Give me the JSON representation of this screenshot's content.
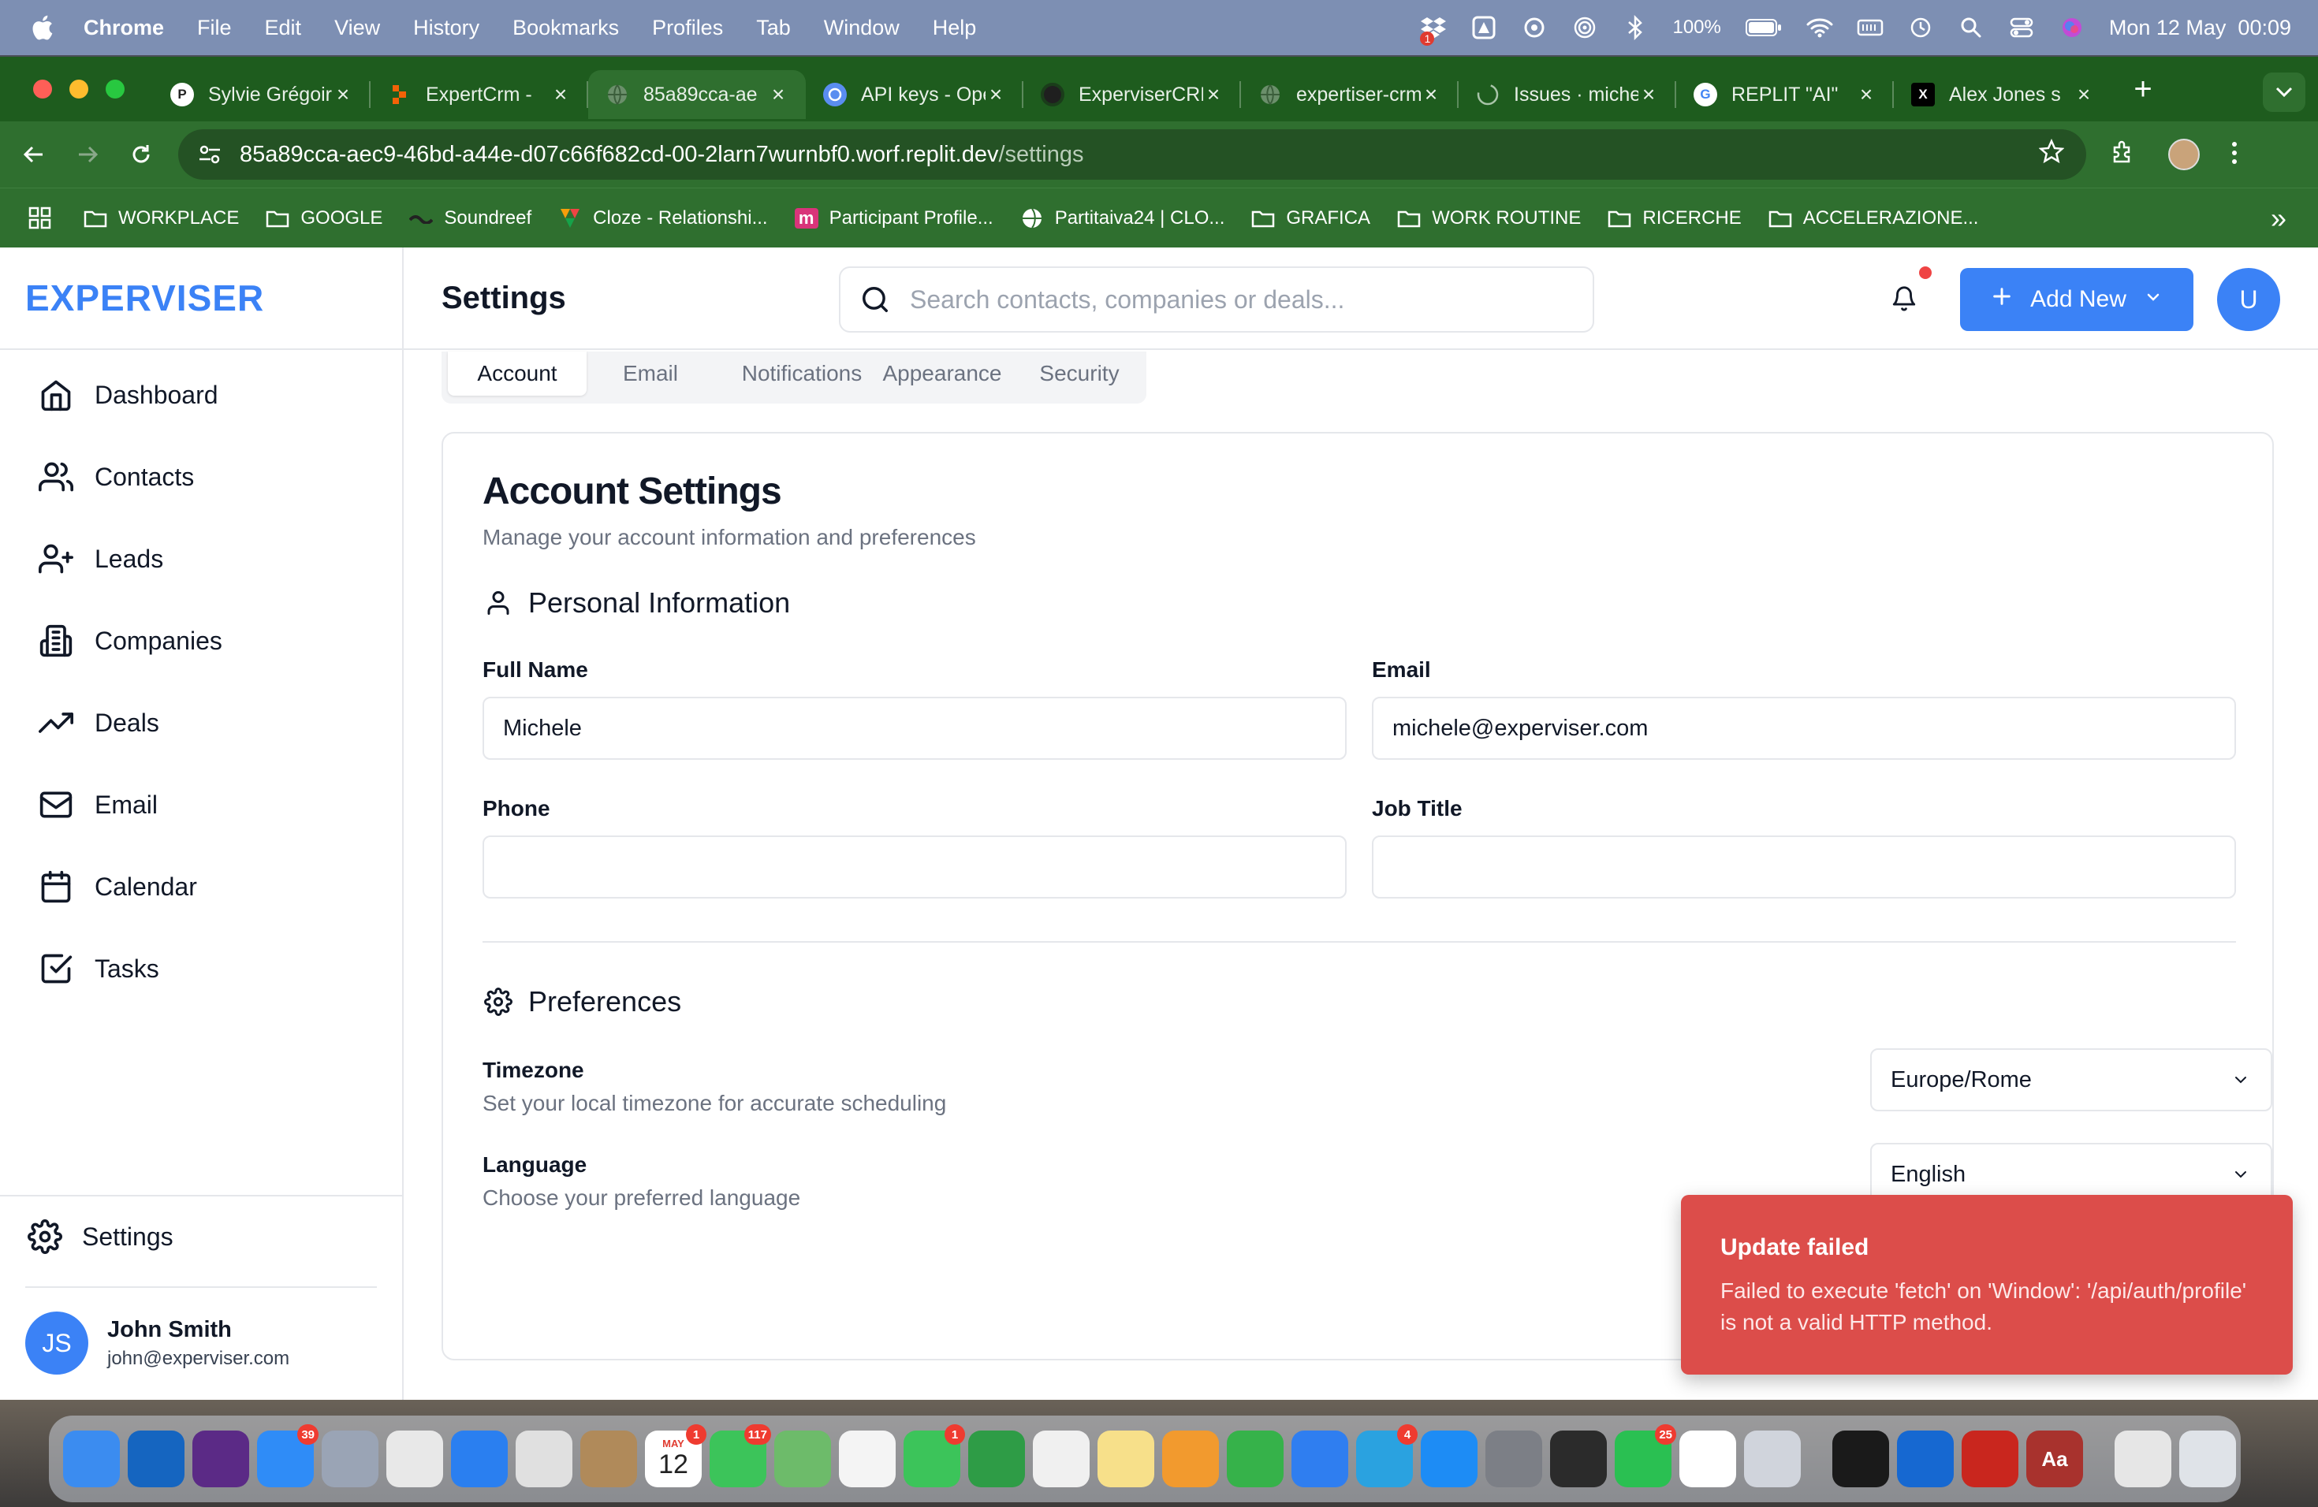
{
  "menubar": {
    "app": "Chrome",
    "items": [
      "File",
      "Edit",
      "View",
      "History",
      "Bookmarks",
      "Profiles",
      "Tab",
      "Window",
      "Help"
    ],
    "battery": "100%",
    "clock": "Mon 12 May  00:09",
    "notification_badge": "1"
  },
  "browser": {
    "tabs": [
      {
        "title": "Sylvie Grégoire",
        "icon": "P"
      },
      {
        "title": "ExpertCrm - ",
        "icon": "replit"
      },
      {
        "title": "85a89cca-ae",
        "icon": "globe",
        "active": true
      },
      {
        "title": "API keys - OpenAI",
        "icon": "openai"
      },
      {
        "title": "ExperviserCRM",
        "icon": "github"
      },
      {
        "title": "expertiser-crm",
        "icon": "globe"
      },
      {
        "title": "Issues · michele",
        "icon": "loading"
      },
      {
        "title": "REPLIT \"AI\"",
        "icon": "G"
      },
      {
        "title": "Alex Jones s",
        "icon": "X"
      }
    ],
    "url_host": "85a89cca-aec9-46bd-a44e-d07c66f682cd-00-2larn7wurnbf0.worf.replit.dev",
    "url_path": "/settings",
    "bookmarks": [
      {
        "label": "WORKPLACE",
        "icon": "folder-icon"
      },
      {
        "label": "GOOGLE",
        "icon": "folder-icon"
      },
      {
        "label": "Soundreef",
        "icon": "soundreef-icon"
      },
      {
        "label": "Cloze - Relationshi...",
        "icon": "cloze-icon"
      },
      {
        "label": "Participant Profile...",
        "icon": "m-icon"
      },
      {
        "label": "Partitaiva24 | CLO...",
        "icon": "globe-icon"
      },
      {
        "label": "GRAFICA",
        "icon": "folder-icon"
      },
      {
        "label": "WORK ROUTINE",
        "icon": "folder-icon"
      },
      {
        "label": "RICERCHE",
        "icon": "folder-icon"
      },
      {
        "label": "ACCELERAZIONE...",
        "icon": "folder-icon"
      }
    ],
    "more": "»"
  },
  "app": {
    "brand": "EXPERVISER",
    "nav": [
      {
        "label": "Dashboard",
        "icon": "home-icon"
      },
      {
        "label": "Contacts",
        "icon": "users-icon"
      },
      {
        "label": "Leads",
        "icon": "user-plus-icon"
      },
      {
        "label": "Companies",
        "icon": "building-icon"
      },
      {
        "label": "Deals",
        "icon": "trending-up-icon"
      },
      {
        "label": "Email",
        "icon": "mail-icon"
      },
      {
        "label": "Calendar",
        "icon": "calendar-icon"
      },
      {
        "label": "Tasks",
        "icon": "check-square-icon"
      }
    ],
    "settings_label": "Settings",
    "user": {
      "initials": "JS",
      "name": "John Smith",
      "email": "john@experviser.com"
    },
    "header": {
      "title": "Settings",
      "search_placeholder": "Search contacts, companies or deals...",
      "add_new": "Add New",
      "avatar_initial": "U"
    },
    "tabs": [
      "Account",
      "Email",
      "Notifications",
      "Appearance",
      "Security"
    ],
    "active_tab": "Account",
    "card": {
      "title": "Account Settings",
      "subtitle": "Manage your account information and preferences",
      "personal_title": "Personal Information",
      "fields": {
        "full_name_label": "Full Name",
        "full_name_value": "Michele",
        "email_label": "Email",
        "email_value": "michele@experviser.com",
        "phone_label": "Phone",
        "phone_value": "",
        "job_title_label": "Job Title",
        "job_title_value": ""
      },
      "preferences_title": "Preferences",
      "timezone_label": "Timezone",
      "timezone_desc": "Set your local timezone for accurate scheduling",
      "timezone_value": "Europe/Rome",
      "language_label": "Language",
      "language_desc": "Choose your preferred language",
      "language_value": "English"
    },
    "toast": {
      "title": "Update failed",
      "message": "Failed to execute 'fetch' on 'Window': '/api/auth/profile' is not a valid HTTP method."
    }
  },
  "dock": {
    "apps": [
      {
        "name": "Finder",
        "color": "#3b8cf0"
      },
      {
        "name": "Outlook",
        "color": "#1565c0"
      },
      {
        "name": "Siri",
        "color": "#5b2a86"
      },
      {
        "name": "Mail",
        "color": "#2f8cf7",
        "badge": "39"
      },
      {
        "name": "Launchpad",
        "color": "#9aa4b5"
      },
      {
        "name": "Chrome",
        "color": "#e8e8e8"
      },
      {
        "name": "Safari",
        "color": "#2a7ff0"
      },
      {
        "name": "Opera",
        "color": "#e0e0e0"
      },
      {
        "name": "Contacts",
        "color": "#b08a5a"
      },
      {
        "name": "Calendar",
        "color": "#ffffff",
        "badge": "1"
      },
      {
        "name": "Messages",
        "color": "#3cc45a",
        "badge": "117"
      },
      {
        "name": "Maps",
        "color": "#6dbb6a"
      },
      {
        "name": "Photos",
        "color": "#f4f4f4"
      },
      {
        "name": "FaceTime",
        "color": "#3cc45a",
        "badge": "1"
      },
      {
        "name": "Chat",
        "color": "#2e9c46"
      },
      {
        "name": "Evernote",
        "color": "#f0f0f0"
      },
      {
        "name": "Notes",
        "color": "#f7e08a"
      },
      {
        "name": "Pages",
        "color": "#f29a2e"
      },
      {
        "name": "Numbers",
        "color": "#36b24a"
      },
      {
        "name": "Keynote",
        "color": "#2f7ef0"
      },
      {
        "name": "Telegram",
        "color": "#2aa2e0",
        "badge": "4"
      },
      {
        "name": "App Store",
        "color": "#1d8cf5"
      },
      {
        "name": "System Settings",
        "color": "#7c7f86"
      },
      {
        "name": "Phone",
        "color": "#2b2b2b"
      },
      {
        "name": "WhatsApp",
        "color": "#2ac052",
        "badge": "25"
      },
      {
        "name": "ChatGPT",
        "color": "#ffffff"
      },
      {
        "name": "iPhone Mirroring",
        "color": "#d0d4dc"
      },
      {
        "name": "Spotify",
        "color": "#1a1a1a"
      },
      {
        "name": "Trello",
        "color": "#1668d1"
      },
      {
        "name": "Acrobat",
        "color": "#c9261e"
      },
      {
        "name": "Dictionary",
        "color": "#a8322d",
        "label": "Aa"
      },
      {
        "name": "Downloads",
        "color": "#e6e6e6"
      },
      {
        "name": "Trash",
        "color": "#dfe3e8"
      }
    ],
    "calendar_day": "12",
    "calendar_month": "MAY"
  },
  "colors": {
    "accent": "#3b82f6",
    "chrome_green": "#2f6f2f",
    "toast_red": "#dc4d4a"
  }
}
